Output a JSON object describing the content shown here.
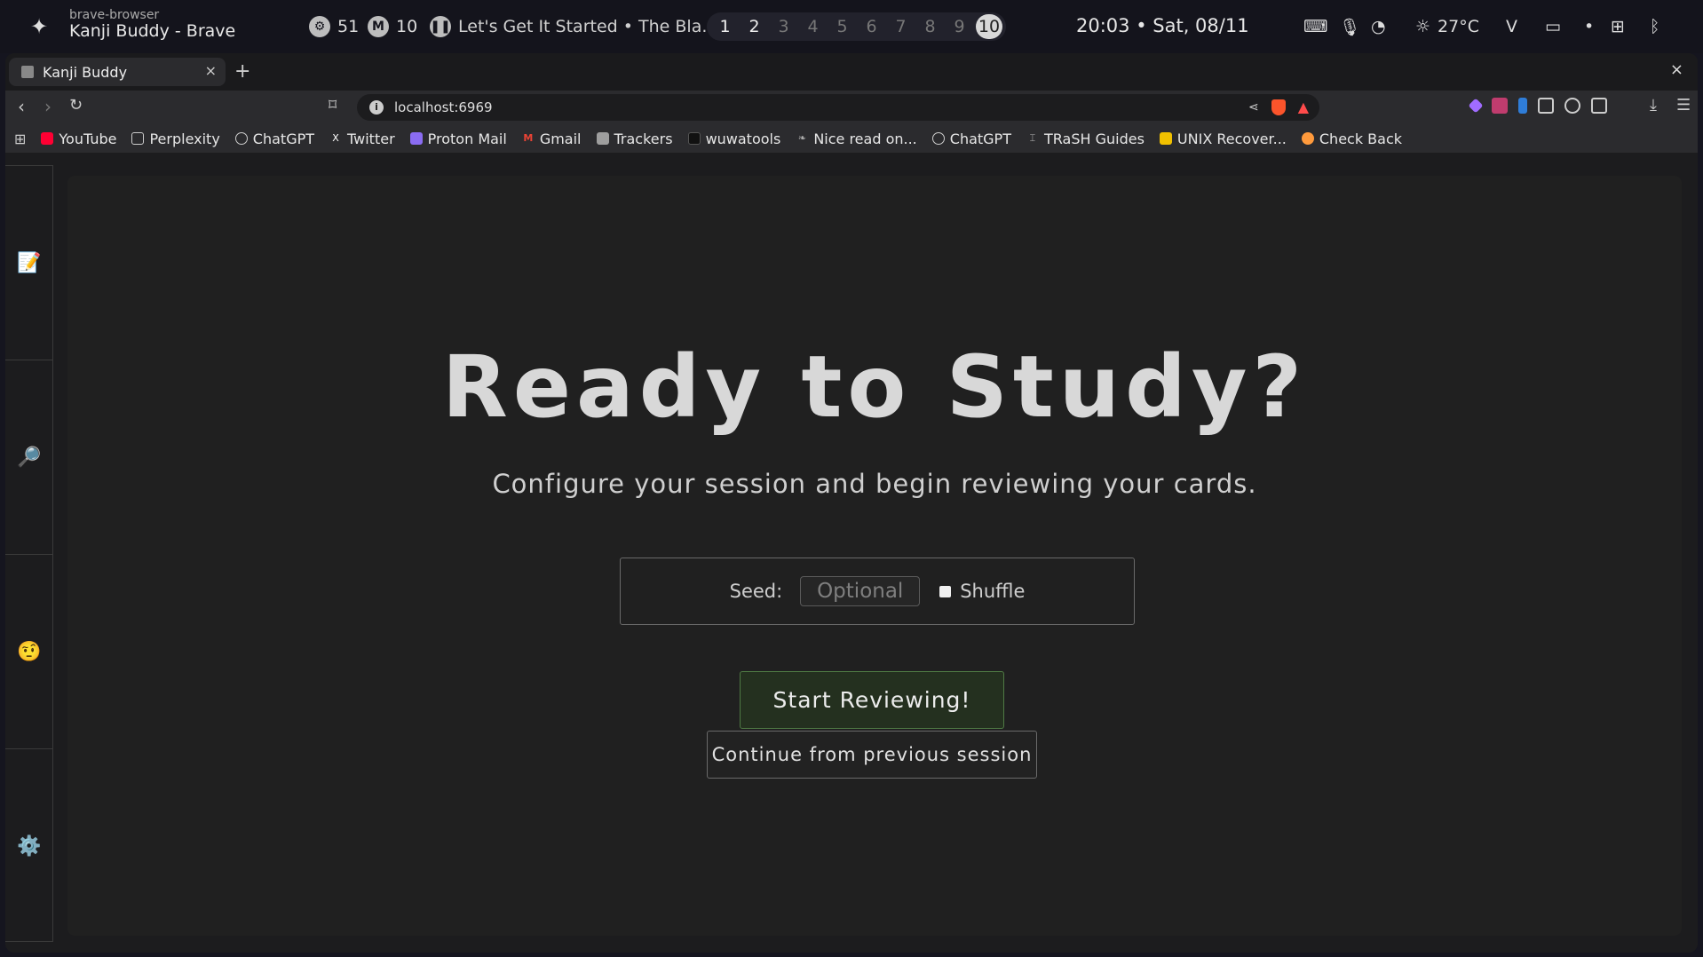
{
  "system_bar": {
    "app_class": "brave-browser",
    "app_title": "Kanji Buddy - Brave",
    "cpu_value": "51",
    "mem_value": "10",
    "media_title": "Let's Get It Started • The Bla...",
    "workspaces": [
      "1",
      "2",
      "3",
      "4",
      "5",
      "6",
      "7",
      "8",
      "9",
      "10"
    ],
    "active_workspace": "10",
    "clock": "20:03 • Sat, 08/11",
    "weather": "27°C"
  },
  "browser": {
    "tab_title": "Kanji Buddy",
    "new_tab_label": "+",
    "close_label": "×",
    "url": "localhost:6969",
    "bookmarks": [
      {
        "label": "YouTube",
        "color": "#ff0033"
      },
      {
        "label": "Perplexity",
        "color": "#cccccc"
      },
      {
        "label": "ChatGPT",
        "color": "#cccccc"
      },
      {
        "label": "Twitter",
        "color": "#ffffff"
      },
      {
        "label": "Proton Mail",
        "color": "#8a6cf2"
      },
      {
        "label": "Gmail",
        "color": "#ea4335"
      },
      {
        "label": "Trackers",
        "color": "#9e9e9e"
      },
      {
        "label": "wuwatools",
        "color": "#333333"
      },
      {
        "label": "Nice read on...",
        "color": "#aaaaaa"
      },
      {
        "label": "ChatGPT",
        "color": "#cccccc"
      },
      {
        "label": "TRaSH Guides",
        "color": "#bbbbbb"
      },
      {
        "label": "UNIX Recover...",
        "color": "#f0c000"
      },
      {
        "label": "Check Back",
        "color": "#ff9a3c"
      }
    ]
  },
  "sidebar": {
    "items": [
      {
        "icon": "memo-icon",
        "glyph": "📝"
      },
      {
        "icon": "magnifier-icon",
        "glyph": "🔎"
      },
      {
        "icon": "face-icon",
        "glyph": "🤨"
      },
      {
        "icon": "gear-icon",
        "glyph": "⚙️"
      }
    ]
  },
  "main": {
    "title": "Ready to Study?",
    "subtitle": "Configure your session and begin reviewing your cards.",
    "seed_label": "Seed:",
    "seed_placeholder": "Optional",
    "shuffle_label": "Shuffle",
    "start_button": "Start Reviewing!",
    "continue_button": "Continue from previous session"
  },
  "colors": {
    "accent_green": "#4f7a44",
    "card_bg": "#202020"
  }
}
